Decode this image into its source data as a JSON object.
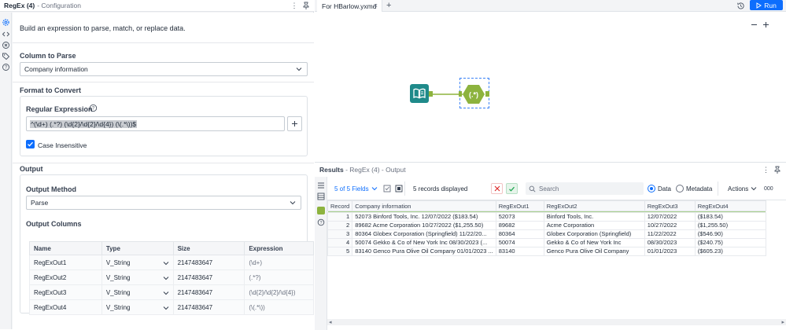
{
  "config": {
    "title": "RegEx (4)",
    "subtitle": "- Configuration",
    "description": "Build an expression to parse, match, or replace data.",
    "column_to_parse_label": "Column to Parse",
    "column_to_parse_value": "Company information",
    "format_label": "Format to Convert",
    "regex_label": "Regular Expression",
    "regex_value": "^(\\d+) (.*?) (\\d{2}/\\d{2}/\\d{4}) (\\(.*\\))$",
    "case_label": "Case Insensitive",
    "case_checked": true,
    "output_label": "Output",
    "output_method_label": "Output Method",
    "output_method_value": "Parse",
    "output_columns_label": "Output Columns",
    "columns_headers": [
      "Name",
      "Type",
      "Size",
      "Expression"
    ],
    "columns": [
      {
        "name": "RegExOut1",
        "type": "V_String",
        "size": "2147483647",
        "expr": "(\\d+)"
      },
      {
        "name": "RegExOut2",
        "type": "V_String",
        "size": "2147483647",
        "expr": "(.*?)"
      },
      {
        "name": "RegExOut3",
        "type": "V_String",
        "size": "2147483647",
        "expr": "(\\d{2}/\\d{2}/\\d{4})"
      },
      {
        "name": "RegExOut4",
        "type": "V_String",
        "size": "2147483647",
        "expr": "(\\(.*\\))"
      }
    ]
  },
  "workflow": {
    "tab_name": "For HBarlow.yxmd",
    "run_label": "Run"
  },
  "results": {
    "title": "Results",
    "subtitle": "- RegEx (4) - Output",
    "fields_label": "5 of 5 Fields",
    "records_label": "5 records displayed",
    "search_placeholder": "Search",
    "data_label": "Data",
    "metadata_label": "Metadata",
    "actions_label": "Actions",
    "headers": [
      "Record",
      "Company information",
      "RegExOut1",
      "RegExOut2",
      "RegExOut3",
      "RegExOut4"
    ],
    "rows": [
      [
        "1",
        "52073 Binford Tools, Inc. 12/07/2022 ($183.54)",
        "52073",
        "Binford Tools, Inc.",
        "12/07/2022",
        "($183.54)"
      ],
      [
        "2",
        "89682 Acme Corporation 10/27/2022 ($1,255.50)",
        "89682",
        "Acme Corporation",
        "10/27/2022",
        "($1,255.50)"
      ],
      [
        "3",
        "80364 Globex Corporation (Springfield) 11/22/20...",
        "80364",
        "Globex Corporation (Springfield)",
        "11/22/2022",
        "($546.90)"
      ],
      [
        "4",
        "50074 Gekko & Co of New York Inc 08/30/2023 (...",
        "50074",
        "Gekko & Co of New York Inc",
        "08/30/2023",
        "($240.75)"
      ],
      [
        "5",
        "83140 Genco Pura Olive Oil Company 01/01/2023 ...",
        "83140",
        "Genco Pura Olive Oil Company",
        "01/01/2023",
        "($605.23)"
      ]
    ]
  },
  "colors": {
    "accent": "#0d6efd",
    "tool_green": "#8db33e",
    "tool_teal": "#1f8a8a"
  }
}
